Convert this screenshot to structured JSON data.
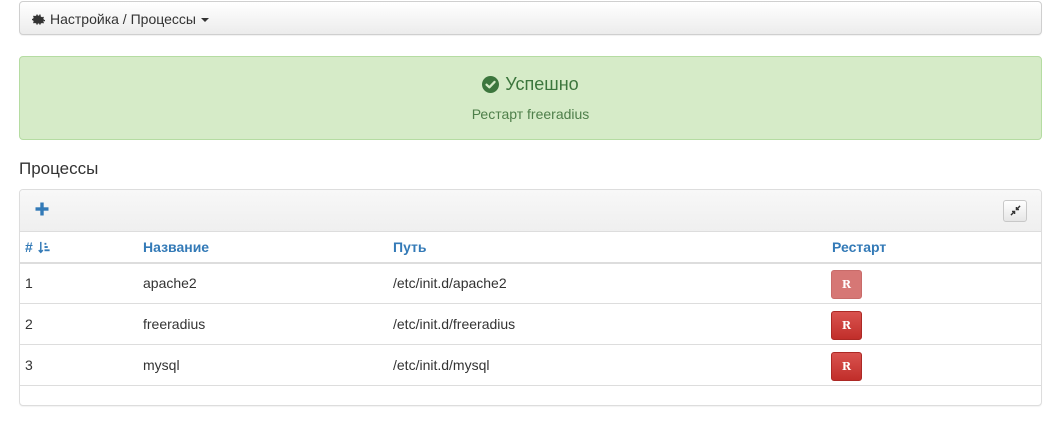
{
  "breadcrumb": {
    "label": "Настройка / Процессы",
    "icon": "gear-icon"
  },
  "alert": {
    "title": "Успешно",
    "message": "Рестарт freeradius",
    "color": "#3c763d"
  },
  "section": {
    "title": "Процессы"
  },
  "table": {
    "columns": {
      "num": "#",
      "name": "Название",
      "path": "Путь",
      "restart": "Рестарт"
    },
    "rows": [
      {
        "num": "1",
        "name": "apache2",
        "path": "/etc/init.d/apache2",
        "button": "R",
        "state": "faded"
      },
      {
        "num": "2",
        "name": "freeradius",
        "path": "/etc/init.d/freeradius",
        "button": "R",
        "state": "normal"
      },
      {
        "num": "3",
        "name": "mysql",
        "path": "/etc/init.d/mysql",
        "button": "R",
        "state": "normal"
      }
    ]
  },
  "colors": {
    "link": "#337ab7",
    "danger": "#d9534f",
    "success_bg": "#d6ebc8"
  }
}
